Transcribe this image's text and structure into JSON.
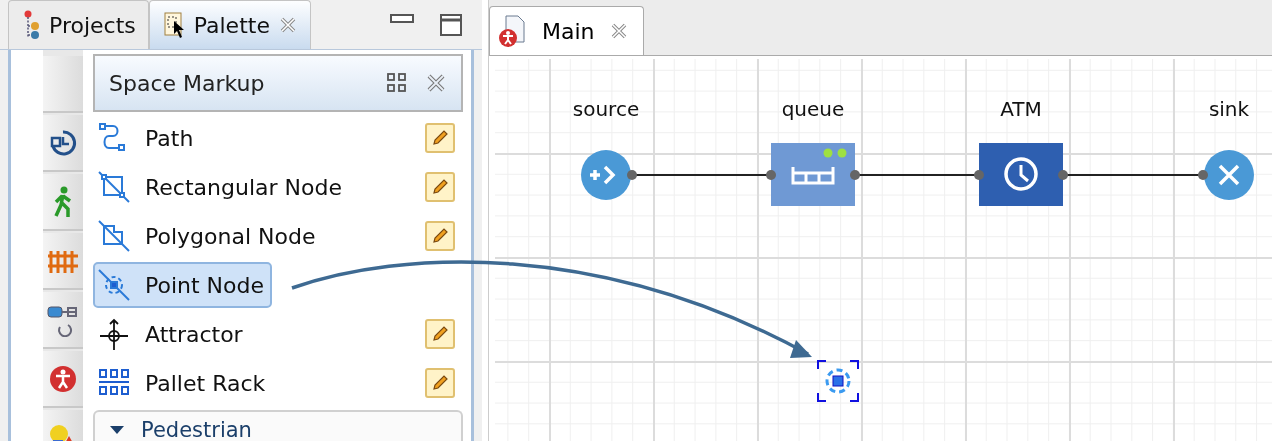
{
  "left_panel": {
    "tabs": [
      {
        "label": "Projects",
        "selected": false,
        "closable": false
      },
      {
        "label": "Palette",
        "selected": true,
        "closable": true
      }
    ]
  },
  "palette": {
    "title": "Space Markup",
    "items": [
      {
        "label": "Path",
        "kind": "path",
        "editable": true,
        "selected": false
      },
      {
        "label": "Rectangular Node",
        "kind": "rect_node",
        "editable": true,
        "selected": false
      },
      {
        "label": "Polygonal Node",
        "kind": "polygon_node",
        "editable": true,
        "selected": false
      },
      {
        "label": "Point Node",
        "kind": "point_node",
        "editable": false,
        "selected": true
      },
      {
        "label": "Attractor",
        "kind": "attractor",
        "editable": true,
        "selected": false
      },
      {
        "label": "Pallet Rack",
        "kind": "pallet_rack",
        "editable": true,
        "selected": false
      }
    ],
    "next_section": {
      "label": "Pedestrian",
      "expanded": true
    }
  },
  "editor": {
    "tabs": [
      {
        "label": "Main",
        "selected": true
      }
    ],
    "blocks": [
      {
        "label": "source",
        "kind": "source"
      },
      {
        "label": "queue",
        "kind": "queue"
      },
      {
        "label": "ATM",
        "kind": "delay"
      },
      {
        "label": "sink",
        "kind": "sink"
      }
    ]
  }
}
